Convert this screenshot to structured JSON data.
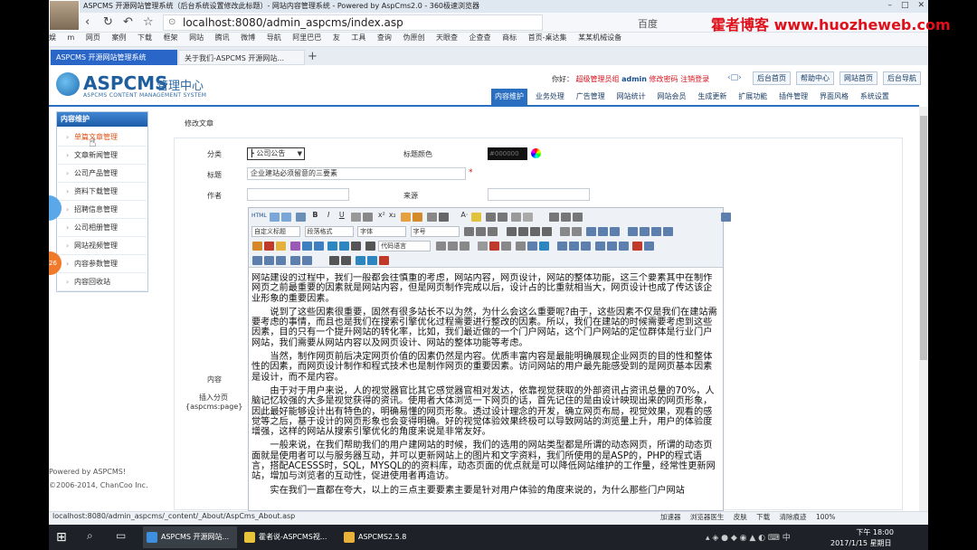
{
  "browser": {
    "window_title": "ASPCMS 开源网站管理系统（后台系统设置修改此标题）- 网站内容管理系统 - Powered by AspCms2.0 - 360极速浏览器",
    "address": "localhost:8080/admin_aspcms/index.asp",
    "search_hint": "百度",
    "overlay_brand": "霍者博客 www.huozheweb.com",
    "bookmarks": [
      "娱",
      "m",
      "网页",
      "案例",
      "下载",
      "框架",
      "网站",
      "腾讯",
      "微博",
      "导航",
      "阿里巴巴",
      "友",
      "工具",
      "查询",
      "伪原创",
      "天眼查",
      "企查查",
      "商标",
      "首页-桌达集",
      "某某机械设备"
    ],
    "tabs": [
      {
        "label": "ASPCMS 开源网站管理系统",
        "active": true
      },
      {
        "label": "关于我们-ASPCMS 开源网站...",
        "active": false
      }
    ],
    "status_url": "localhost:8080/admin_aspcms/_content/_About/AspCms_About.asp",
    "status_items": [
      "加速器",
      "浏览器医生",
      "皮肤",
      "下载",
      "清除痕迹",
      "100%"
    ]
  },
  "header": {
    "logo": "ASPCMS",
    "logo_sub": "管理中心",
    "logo_en": "ASPCMS CONTENT MANAGEMENT SYSTEM",
    "greeting": "你好：",
    "role": "超级管理员组",
    "user": "admin",
    "change_pwd": "修改密码",
    "logout": "注销登录",
    "buttons": [
      "后台首页",
      "帮助中心",
      "网站首页",
      "后台导航"
    ]
  },
  "main_nav": [
    "内容维护",
    "业务处理",
    "广告管理",
    "网站统计",
    "网站会员",
    "生成更新",
    "扩展功能",
    "插件管理",
    "界面风格",
    "系统设置"
  ],
  "sidebar": {
    "title": "内容维护",
    "items": [
      "单篇文章管理",
      "文章新闻管理",
      "公司产品管理",
      "资料下载管理",
      "招聘信息管理",
      "公司相册管理",
      "网站视频管理",
      "内容参数管理",
      "内容回收站"
    ]
  },
  "side_badge": "26",
  "footer": {
    "powered": "Powered by ASPCMS!",
    "copyright": "©2006-2014, ChanCoo Inc."
  },
  "form": {
    "breadcrumb": "修改文章",
    "category_label": "分类",
    "category_value": "┣ 公司公告",
    "title_color_label": "标题颜色",
    "title_color_value": "#000000",
    "title_label": "标题",
    "title_value": "企业建站必须留意的三要素",
    "author_label": "作者",
    "source_label": "来源",
    "content_label": "内容",
    "paging_label": "插入分页",
    "paging_tag": "{aspcms:page}",
    "required_mark": "*"
  },
  "editor": {
    "selects": [
      "自定义标题",
      "段落格式",
      "字体",
      "字号",
      "代码语言"
    ],
    "paragraphs": [
      "网站建设的过程中，我们一般都会往慎重的考虑，网站内容，网页设计，网站的整体功能，这三个要素其中在制作网页之前最重要的因素就是网站内容，但是网页制作完成以后，设计占的比重就相当大，网页设计也成了传达该企业形象的重要因素。",
      "说到了这些因素很重要，固然有很多站长不以为然，为什么会这么重要呢?由于，这些因素不仅是我们在建站需要考虑的事情，而且也是我们在搜索引擎优化过程需要进行整改的因素。所以，我们在建站的时候需要考虑到这些因素，目的只有一个提升网站的转化率，比如，我们最近做的一个门户网站，这个门户网站的定位群体是行业门户网站，我们需要从网站内容以及网页设计、网站的整体功能等考虑。",
      "当然，制作网页前后决定网页价值的因素仍然是内容。优质丰富内容是最能明确展现企业网页的目的性和整体性的因素，而网页设计制作和程式技术也是制作网页的重要因素。访问网站的用户最先能感受到的是网页基本因素是设计，而不是内容。",
      "由于对于用户来说，人的视觉器官比其它感觉器官相对发达，依靠视觉获取的外部资讯占资讯总量的70%，人脑记忆较强的大多是视觉获得的资讯。使用者大体浏览一下网页的话，首先记住的是由设计映现出来的网页形象，因此最好能够设计出有特色的，明确易懂的网页形象。透过设计理念的开发，确立网页布局，视觉效果，观看的感觉等之后，基于设计的网页形象也会变得明确。好的视觉体验效果终极可以导致网站的浏览量上升，用户的体验度增强，这样的网站从搜索引擎优化的角度来说是非常友好。",
      "一般来说，在我们帮助我们的用户建网站的时候，我们的选用的网站类型都是所谓的动态网页，所谓的动态页面就是使用者可以与服务器互动，并可以更新网站上的图片和文字资料，我们所使用的是ASP的，PHP的程式语言，搭配ACESSS时，SQL，MYSQL的的资料库，动态页面的优点就是可以降低网站维护的工作量，经常性更新网站，增加与浏览者的互动性，促进使用者再造访。",
      "实在我们一直都在夸大，以上的三点主要要素主要是针对用户体验的角度来说的，为什么那些门户网站"
    ]
  },
  "taskbar": {
    "items": [
      "ASPCMS 开源网站...",
      "霍者说-ASPCMS视...",
      "ASPCMS2.5.8"
    ],
    "time": "下午 18:00",
    "date": "2017/1/15 星期日"
  }
}
